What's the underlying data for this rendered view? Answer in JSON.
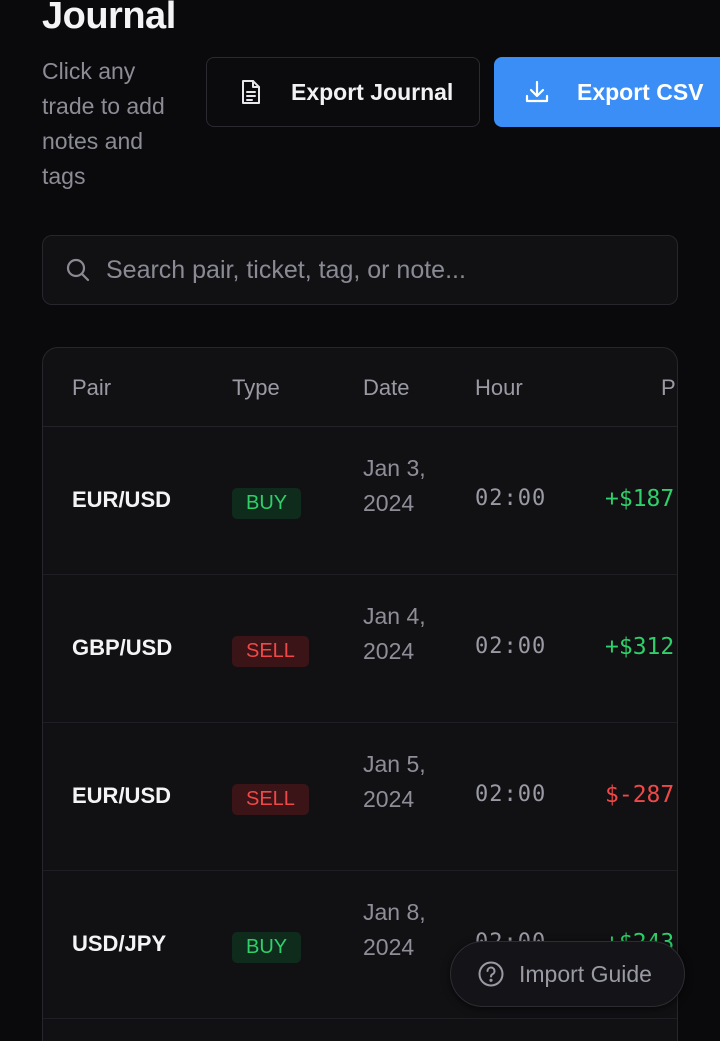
{
  "header": {
    "title": "Journal",
    "subtitle": "Click any trade to add notes and tags"
  },
  "actions": {
    "export_journal_label": "Export Journal",
    "export_csv_label": "Export CSV",
    "export_journal_icon": "document-icon",
    "export_csv_icon": "download-icon"
  },
  "search": {
    "placeholder": "Search pair, ticket, tag, or note..."
  },
  "table": {
    "columns": [
      "Pair",
      "Type",
      "Date",
      "Hour",
      "P"
    ],
    "rows": [
      {
        "pair": "EUR/USD",
        "type": "BUY",
        "date": "Jan 3, 2024",
        "hour": "02:00",
        "pnl": "+$187"
      },
      {
        "pair": "GBP/USD",
        "type": "SELL",
        "date": "Jan 4, 2024",
        "hour": "02:00",
        "pnl": "+$312"
      },
      {
        "pair": "EUR/USD",
        "type": "SELL",
        "date": "Jan 5, 2024",
        "hour": "02:00",
        "pnl": "$-287"
      },
      {
        "pair": "USD/JPY",
        "type": "BUY",
        "date": "Jan 8, 2024",
        "hour": "02:00",
        "pnl": "+$243"
      }
    ]
  },
  "floating": {
    "import_guide_label": "Import Guide",
    "import_guide_icon": "help-circle-icon"
  },
  "colors": {
    "accent": "#3b8ef5",
    "positive": "#2fcf6a",
    "negative": "#f04848",
    "background": "#0a0a0c"
  }
}
